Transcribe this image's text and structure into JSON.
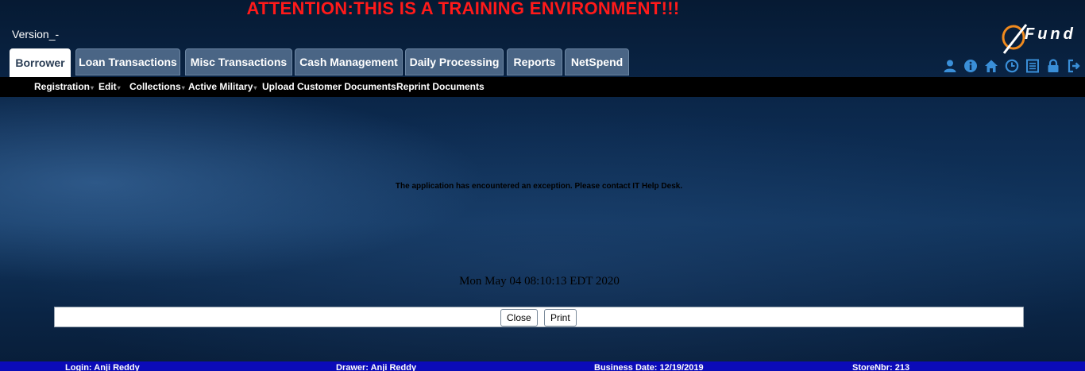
{
  "banner": {
    "attention": "ATTENTION:THIS IS A TRAINING ENVIRONMENT!!!"
  },
  "header": {
    "version": "Version_-",
    "logo_text": "Fund"
  },
  "tabs": [
    {
      "label": "Borrower",
      "active": true
    },
    {
      "label": "Loan Transactions",
      "active": false
    },
    {
      "label": "Misc Transactions",
      "active": false
    },
    {
      "label": "Cash Management",
      "active": false
    },
    {
      "label": "Daily Processing",
      "active": false
    },
    {
      "label": "Reports",
      "active": false
    },
    {
      "label": "NetSpend",
      "active": false
    }
  ],
  "toolbar_icons": [
    "user-icon",
    "info-icon",
    "home-icon",
    "clock-icon",
    "list-icon",
    "lock-icon",
    "logout-icon"
  ],
  "submenu": [
    {
      "label": "Registration",
      "has_dropdown": true
    },
    {
      "label": "Edit",
      "has_dropdown": true
    },
    {
      "label": "Collections",
      "has_dropdown": true
    },
    {
      "label": "Active Military",
      "has_dropdown": true
    },
    {
      "label": "Upload Customer Documents",
      "has_dropdown": false
    },
    {
      "label": "Reprint Documents",
      "has_dropdown": false
    }
  ],
  "main": {
    "error_message": "The application has encountered an exception. Please contact IT Help Desk.",
    "datetime": "Mon May 04 08:10:13 EDT 2020",
    "close_label": "Close",
    "print_label": "Print"
  },
  "status": {
    "login": "Login: Anji Reddy",
    "drawer": "Drawer: Anji Reddy",
    "business_date": "Business Date: 12/19/2019",
    "store": "StoreNbr: 213"
  },
  "colors": {
    "attention": "#ff1a1a",
    "tab_bg": "#4a6585",
    "icon_blue": "#3a8fd8",
    "statusbar": "#0b0bb8",
    "logo_orange": "#f08a1e"
  }
}
